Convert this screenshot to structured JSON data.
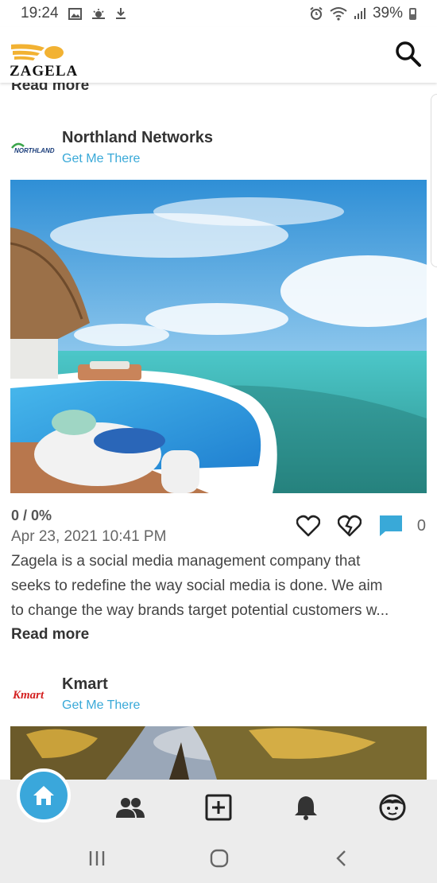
{
  "status_bar": {
    "time": "19:24",
    "battery_percent": "39%",
    "icons_left": [
      "gallery-icon",
      "weather-icon",
      "download-icon"
    ],
    "icons_right": [
      "alarm-icon",
      "wifi-icon",
      "signal-icon",
      "battery-icon"
    ]
  },
  "header": {
    "logo_text": "ZAGELA",
    "search_icon": "search-icon"
  },
  "feed": {
    "previous_post_read_more": "Read more",
    "posts": [
      {
        "brand_name": "Northland Networks",
        "brand_logo_text": "NORTHLAND",
        "link_text": "Get Me There",
        "score": "0 / 0%",
        "date": "Apr 23, 2021 10:41 PM",
        "comment_count": "0",
        "text_lines": [
          "Zagela is a social media management company that",
          "seeks to redefine the way social media is done. We aim",
          "to change the way brands target potential customers w..."
        ],
        "read_more": "Read more"
      },
      {
        "brand_name": "Kmart",
        "brand_logo_text": "Kmart",
        "link_text": "Get Me There"
      }
    ]
  },
  "bottom_nav": {
    "items": [
      "home-icon",
      "people-icon",
      "add-post-icon",
      "notifications-icon",
      "profile-icon"
    ],
    "active": "home-icon"
  },
  "system_nav": {
    "items": [
      "recent-apps-icon",
      "home-circle-icon",
      "back-icon"
    ]
  },
  "colors": {
    "accent": "#39a9d8",
    "text": "#333333",
    "kmart_red": "#d42020"
  }
}
